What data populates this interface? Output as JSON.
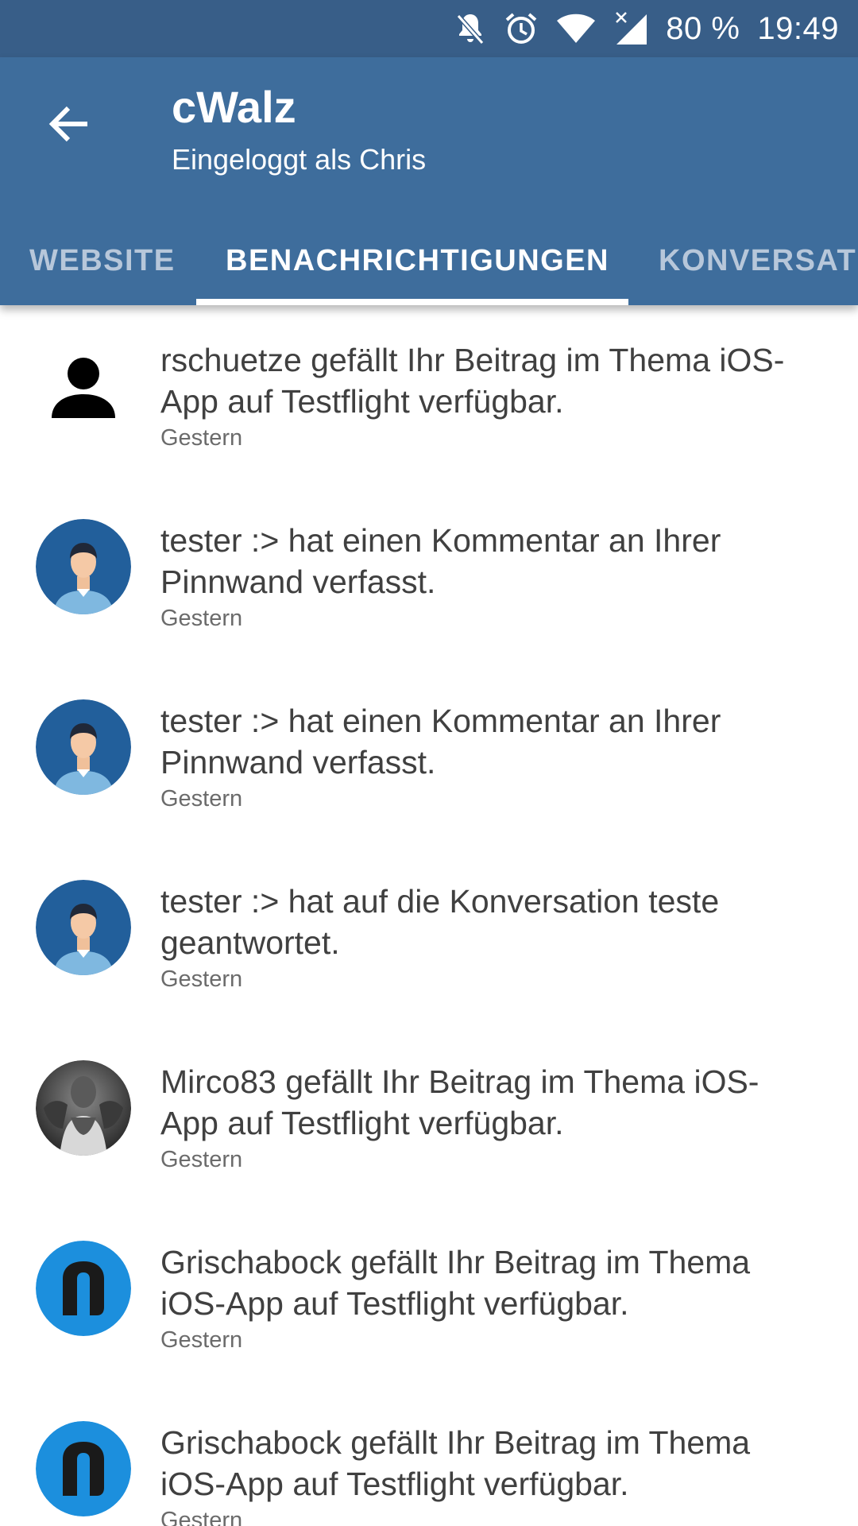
{
  "status_bar": {
    "battery": "80 %",
    "time": "19:49",
    "icons": [
      "bell-off-icon",
      "alarm-icon",
      "wifi-icon",
      "signal-icon"
    ]
  },
  "app_bar": {
    "title": "cWalz",
    "subtitle": "Eingeloggt als Chris",
    "background": "#3e6d9c",
    "status_background": "#385e88"
  },
  "tabs": [
    {
      "label": "WEBSITE",
      "selected": false
    },
    {
      "label": "BENACHRICHTIGUNGEN",
      "selected": true
    },
    {
      "label": "KONVERSATIONEN",
      "selected": false
    }
  ],
  "notifications": [
    {
      "avatar": "default-person-icon",
      "message": "rschuetze gefällt Ihr Beitrag im Thema iOS-App auf Testflight verfügbar.",
      "time": "Gestern"
    },
    {
      "avatar": "man-avatar",
      "message": "tester :> hat einen Kommentar an Ihrer Pinnwand verfasst.",
      "time": "Gestern"
    },
    {
      "avatar": "man-avatar",
      "message": "tester :> hat einen Kommentar an Ihrer Pinnwand verfasst.",
      "time": "Gestern"
    },
    {
      "avatar": "man-avatar",
      "message": "tester :> hat auf die Konversation teste geantwortet.",
      "time": "Gestern"
    },
    {
      "avatar": "photo-avatar",
      "message": "Mirco83 gefällt Ihr Beitrag im Thema iOS-App auf Testflight verfügbar.",
      "time": "Gestern"
    },
    {
      "avatar": "logo-avatar",
      "message": "Grischabock gefällt Ihr Beitrag im Thema iOS-App auf Testflight verfügbar.",
      "time": "Gestern"
    },
    {
      "avatar": "logo-avatar",
      "message": "Grischabock gefällt Ihr Beitrag im Thema iOS-App auf Testflight verfügbar.",
      "time": "Gestern"
    }
  ]
}
